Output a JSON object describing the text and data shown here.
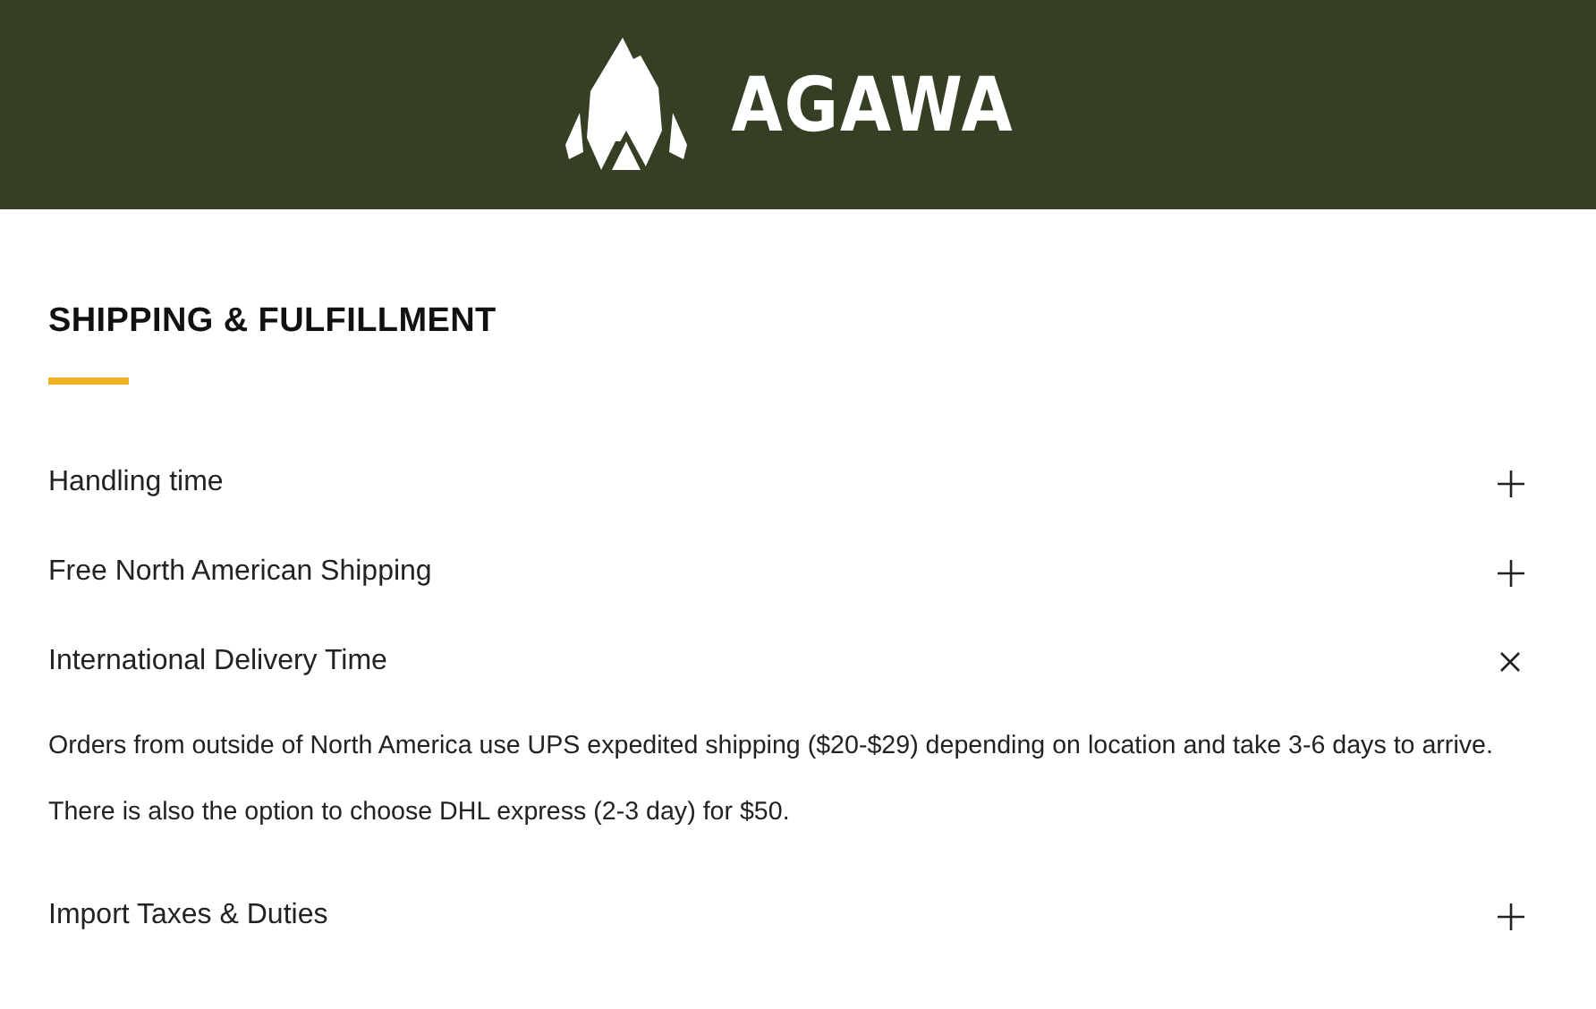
{
  "header": {
    "brand": "AGAWA"
  },
  "section": {
    "title": "SHIPPING & FULFILLMENT"
  },
  "faq": [
    {
      "question": "Handling time",
      "expanded": false
    },
    {
      "question": "Free North American Shipping",
      "expanded": false
    },
    {
      "question": "International Delivery Time",
      "expanded": true,
      "answer": "Orders from outside of North America use UPS expedited shipping ($20-$29) depending on location and take 3-6 days to arrive.  There is also the option to choose DHL express (2-3 day) for $50."
    },
    {
      "question": "Import Taxes & Duties",
      "expanded": false
    }
  ]
}
